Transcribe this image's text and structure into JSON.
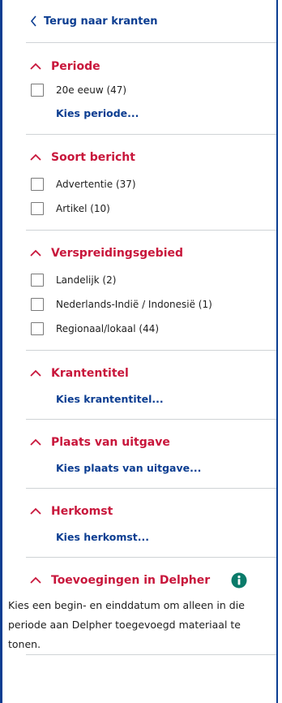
{
  "nav": {
    "back_label": "Terug naar kranten"
  },
  "sections": {
    "periode": {
      "title": "Periode",
      "options": [
        "20e eeuw (47)"
      ],
      "choose_label": "Kies periode..."
    },
    "soort": {
      "title": "Soort bericht",
      "options": [
        "Advertentie (37)",
        "Artikel (10)"
      ]
    },
    "verspreiding": {
      "title": "Verspreidingsgebied",
      "options": [
        "Landelijk (2)",
        "Nederlands-Indië / Indonesië (1)",
        "Regionaal/lokaal (44)"
      ]
    },
    "krantentitel": {
      "title": "Krantentitel",
      "choose_label": "Kies krantentitel..."
    },
    "plaats": {
      "title": "Plaats van uitgave",
      "choose_label": "Kies plaats van uitgave..."
    },
    "herkomst": {
      "title": "Herkomst",
      "choose_label": "Kies herkomst..."
    },
    "toevoegingen": {
      "title": "Toevoegingen in Delpher",
      "description": "Kies een begin- en einddatum om alleen in die periode aan Delpher toegevoegd materiaal te tonen."
    }
  },
  "colors": {
    "accent": "#c8163b",
    "link": "#0b3d91",
    "info_icon": "#0a7b6a"
  },
  "icons": {
    "back": "chevron-left-icon",
    "collapse": "chevron-up-icon",
    "info": "info-icon"
  }
}
